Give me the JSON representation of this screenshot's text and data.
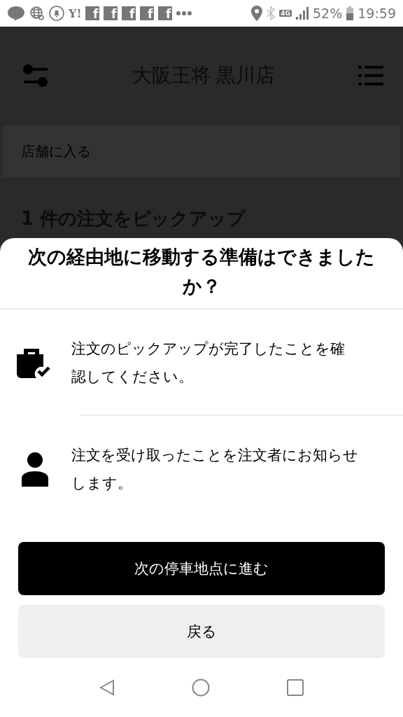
{
  "status_bar": {
    "notifications": [
      {
        "kind": "line"
      },
      {
        "kind": "globe"
      },
      {
        "kind": "bell"
      },
      {
        "kind": "text",
        "label": "Y!"
      },
      {
        "kind": "tile",
        "label": "f"
      },
      {
        "kind": "tile",
        "label": "f"
      },
      {
        "kind": "tile",
        "label": "f"
      },
      {
        "kind": "tile",
        "label": "f"
      },
      {
        "kind": "tile",
        "label": "f"
      },
      {
        "kind": "more"
      }
    ],
    "network": "4G",
    "battery": "52%",
    "time": "19:59"
  },
  "header": {
    "title": "大阪王将 黒川店"
  },
  "background": {
    "card_text": "店舗に入る",
    "section_title": "1 件の注文をピックアップ"
  },
  "sheet": {
    "title": "次の経由地に移動する準備はできましたか？",
    "items": [
      {
        "kind": "bag",
        "text": "注文のピックアップが完了したことを確認してください。"
      },
      {
        "kind": "person",
        "text": "注文を受け取ったことを注文者にお知らせします。"
      }
    ],
    "buttons": [
      {
        "kind": "primary",
        "label": "次の停車地点に進む"
      },
      {
        "kind": "secondary",
        "label": "戻る"
      }
    ]
  }
}
